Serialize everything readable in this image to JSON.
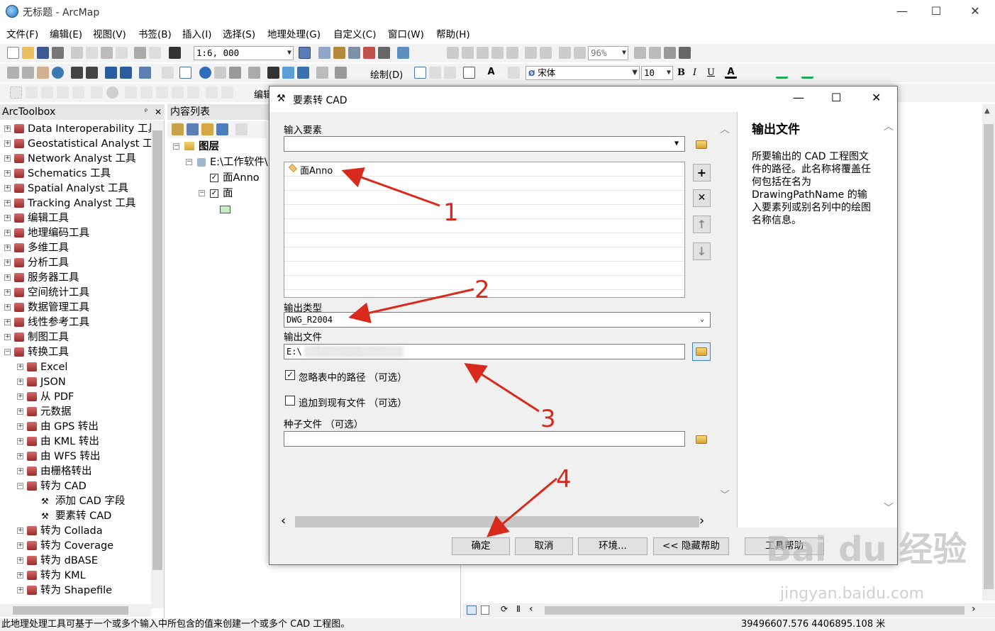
{
  "window": {
    "title": "无标题 - ArcMap",
    "min": "—",
    "max": "☐",
    "close": "✕"
  },
  "menu": [
    "文件(F)",
    "编辑(E)",
    "视图(V)",
    "书签(B)",
    "插入(I)",
    "选择(S)",
    "地理处理(G)",
    "自定义(C)",
    "窗口(W)",
    "帮助(H)"
  ],
  "toolbar": {
    "scale": "1:6, 000",
    "zoom": "96%",
    "draw_label": "绘制(D)",
    "font": "宋体",
    "font_size": "10",
    "bold": "B",
    "italic": "I",
    "underline": "U",
    "edit_label": "编辑"
  },
  "toolbox": {
    "title": "ArcToolbox",
    "pin": "📌",
    "close": "✕",
    "items": [
      "Data Interoperability 工具",
      "Geostatistical Analyst 工具",
      "Network Analyst 工具",
      "Schematics 工具",
      "Spatial Analyst 工具",
      "Tracking Analyst 工具",
      "编辑工具",
      "地理编码工具",
      "多维工具",
      "分析工具",
      "服务器工具",
      "空间统计工具",
      "数据管理工具",
      "线性参考工具",
      "制图工具",
      "转换工具"
    ],
    "sub_items": [
      "Excel",
      "JSON",
      "从 PDF",
      "元数据",
      "由 GPS 转出",
      "由 KML 转出",
      "由 WFS 转出",
      "由栅格转出",
      "转为 CAD"
    ],
    "tools": [
      "添加 CAD 字段",
      "要素转 CAD"
    ],
    "sub_items_after": [
      "转为 Collada",
      "转为 Coverage",
      "转为 dBASE",
      "转为 KML",
      "转为 Shapefile"
    ]
  },
  "toc": {
    "title": "内容列表",
    "layers_root": "图层",
    "folder": "E:\\工作软件\\",
    "layer1": "面Anno",
    "layer2": "面"
  },
  "dialog": {
    "title": "要素转 CAD",
    "input_features_label": "输入要素",
    "input_item": "面Anno",
    "output_type_label": "输出类型",
    "output_type": "DWG_R2004",
    "output_file_label": "输出文件",
    "output_file": "E:\\                         \\转出CAD注记. DWG",
    "ignore_paths_label": "忽略表中的路径 （可选）",
    "append_label": "追加到现有文件 （可选）",
    "seed_file_label": "种子文件 （可选）",
    "ok": "确定",
    "cancel": "取消",
    "env": "环境...",
    "hide_help": "<< 隐藏帮助",
    "tool_help": "工具帮助",
    "help_title": "输出文件",
    "help_text": "所要输出的 CAD 工程图文件的路径。此名称将覆盖任何包括在名为 DrawingPathName 的输入要素列或别名列中的绘图名称信息。"
  },
  "annotations": [
    "1",
    "2",
    "3",
    "4"
  ],
  "statusbar": {
    "message": "此地理处理工具可基于一个或多个输入中所包含的值来创建一个或多个 CAD 工程图。",
    "coords": "39496607.576  4406895.108 米"
  },
  "watermark": {
    "brand": "Bai du 经验",
    "url": "jingyan.baidu.com"
  }
}
